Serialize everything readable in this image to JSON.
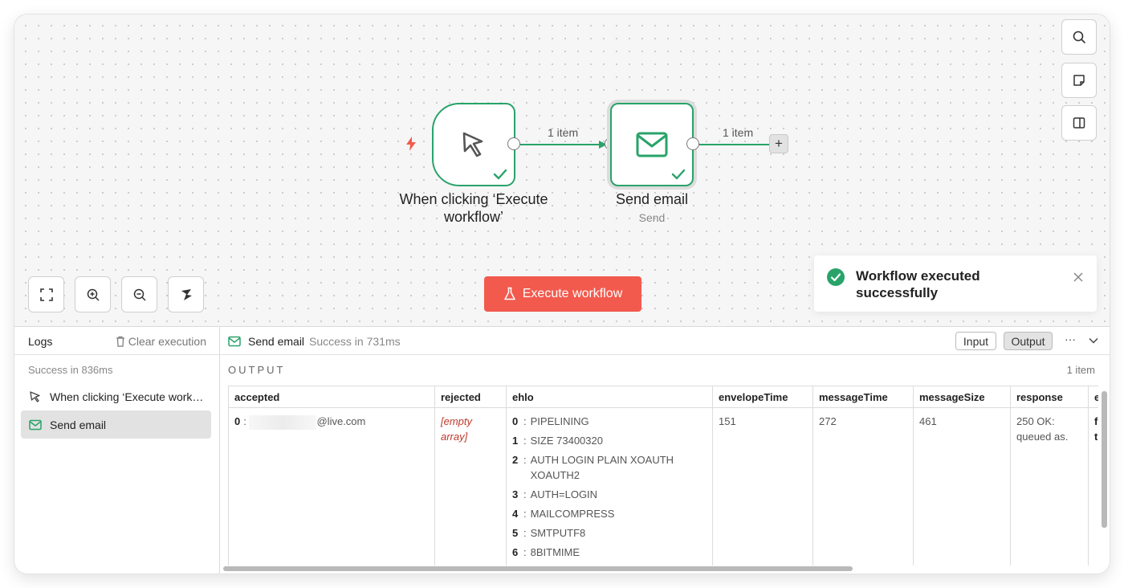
{
  "canvas": {
    "trigger_node": {
      "title": "When clicking ‘Execute workflow’",
      "icon": "cursor-icon"
    },
    "email_node": {
      "title": "Send email",
      "subtitle": "Send",
      "icon": "envelope-icon"
    },
    "connection_1_label": "1 item",
    "connection_2_label": "1 item",
    "execute_button_label": "Execute workflow",
    "colors": {
      "success": "#29a36a",
      "execute": "#f25a4d",
      "trigger_bolt": "#f25a4d"
    }
  },
  "toast": {
    "message": "Workflow executed successfully"
  },
  "logs": {
    "title": "Logs",
    "clear_label": "Clear execution",
    "status": "Success in 836ms",
    "items": [
      {
        "label": "When clicking ‘Execute work…",
        "icon": "cursor-icon"
      },
      {
        "label": "Send email",
        "icon": "envelope-icon"
      }
    ]
  },
  "output": {
    "node_title": "Send email",
    "status": "Success in 731ms",
    "input_tab": "Input",
    "output_tab": "Output",
    "section_label": "OUTPUT",
    "item_count": "1 item",
    "columns": [
      "accepted",
      "rejected",
      "ehlo",
      "envelopeTime",
      "messageTime",
      "messageSize",
      "response",
      "e"
    ],
    "accepted": {
      "key": "0",
      "value": "@live.com"
    },
    "rejected": "[empty array]",
    "ehlo": [
      {
        "key": "0",
        "value": "PIPELINING"
      },
      {
        "key": "1",
        "value": "SIZE 73400320"
      },
      {
        "key": "2",
        "value": "AUTH LOGIN PLAIN XOAUTH XOAUTH2"
      },
      {
        "key": "3",
        "value": "AUTH=LOGIN"
      },
      {
        "key": "4",
        "value": "MAILCOMPRESS"
      },
      {
        "key": "5",
        "value": "SMTPUTF8"
      },
      {
        "key": "6",
        "value": "8BITMIME"
      }
    ],
    "envelopeTime": "151",
    "messageTime": "272",
    "messageSize": "461",
    "response": "250 OK: queued as.",
    "last_col_values": [
      "f",
      "t"
    ]
  }
}
